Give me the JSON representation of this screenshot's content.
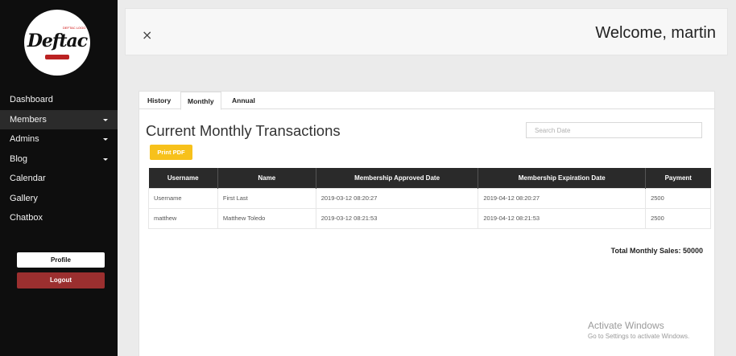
{
  "app": {
    "logo_text": "Deftac",
    "logo_small_text": "DEFTAC LOGO"
  },
  "sidebar": {
    "items": [
      {
        "label": "Dashboard",
        "caret": false,
        "active": false
      },
      {
        "label": "Members",
        "caret": true,
        "active": true
      },
      {
        "label": "Admins",
        "caret": true,
        "active": false
      },
      {
        "label": "Blog",
        "caret": true,
        "active": false
      },
      {
        "label": "Calendar",
        "caret": false,
        "active": false
      },
      {
        "label": "Gallery",
        "caret": false,
        "active": false
      },
      {
        "label": "Chatbox",
        "caret": false,
        "active": false
      }
    ],
    "profile_label": "Profile",
    "logout_label": "Logout"
  },
  "header": {
    "close_glyph": "×",
    "welcome": "Welcome, martin"
  },
  "tabs": [
    {
      "label": "History"
    },
    {
      "label": "Monthly"
    },
    {
      "label": "Annual"
    }
  ],
  "main": {
    "title": "Current Monthly Transactions",
    "search_placeholder": "Search Date",
    "print_label": "Print PDF",
    "table": {
      "headers": [
        "Username",
        "Name",
        "Membership Approved Date",
        "Membership Expiration Date",
        "Payment"
      ],
      "rows": [
        [
          "Username",
          "First Last",
          "2019-03-12 08:20:27",
          "2019-04-12 08:20:27",
          "2500"
        ],
        [
          "matthew",
          "Matthew Toledo",
          "2019-03-12 08:21:53",
          "2019-04-12 08:21:53",
          "2500"
        ]
      ]
    },
    "total": "Total Monthly Sales: 50000"
  },
  "watermark": {
    "title": "Activate Windows",
    "subtitle": "Go to Settings to activate Windows."
  },
  "colors": {
    "sidebar_bg": "#0e0e0e",
    "active_item_bg": "#2b2b2b",
    "logout_bg": "#9b2f2f",
    "print_bg": "#f7c11b",
    "table_header_bg": "#2a2a2a"
  }
}
